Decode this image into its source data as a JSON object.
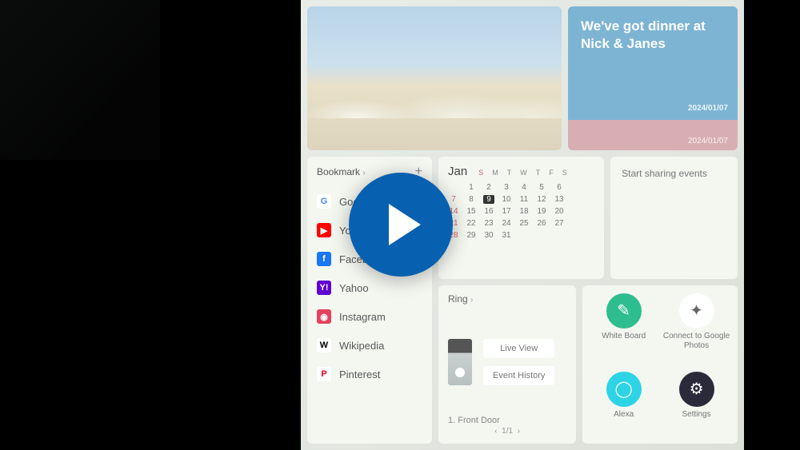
{
  "reminder": {
    "text": "We've got dinner at Nick & Janes",
    "date1": "2024/01/07",
    "date2": "2024/01/07"
  },
  "bookmark": {
    "title": "Bookmark",
    "items": [
      {
        "label": "Google",
        "icon": "G",
        "bg": "#fff",
        "fg": "#4285F4"
      },
      {
        "label": "YouTube",
        "icon": "▶",
        "bg": "#FF0000",
        "fg": "#fff"
      },
      {
        "label": "Facebook",
        "icon": "f",
        "bg": "#1877F2",
        "fg": "#fff"
      },
      {
        "label": "Yahoo",
        "icon": "Y!",
        "bg": "#6001D2",
        "fg": "#fff"
      },
      {
        "label": "Instagram",
        "icon": "◉",
        "bg": "#E4405F",
        "fg": "#fff"
      },
      {
        "label": "Wikipedia",
        "icon": "W",
        "bg": "#fff",
        "fg": "#000"
      },
      {
        "label": "Pinterest",
        "icon": "P",
        "bg": "#fff",
        "fg": "#E60023"
      }
    ]
  },
  "calendar": {
    "month": "Jan",
    "days": [
      "S",
      "M",
      "T",
      "W",
      "T",
      "F",
      "S"
    ],
    "today": 9,
    "weeks": [
      [
        "",
        "1",
        "2",
        "3",
        "4",
        "5",
        "6"
      ],
      [
        "7",
        "8",
        "9",
        "10",
        "11",
        "12",
        "13"
      ],
      [
        "14",
        "15",
        "16",
        "17",
        "18",
        "19",
        "20"
      ],
      [
        "21",
        "22",
        "23",
        "24",
        "25",
        "26",
        "27"
      ],
      [
        "28",
        "29",
        "30",
        "31",
        "",
        "",
        ""
      ]
    ]
  },
  "events": {
    "placeholder": "Start sharing events"
  },
  "ring": {
    "title": "Ring",
    "live": "Live View",
    "history": "Event History",
    "device": "1. Front Door",
    "pager": "1/1"
  },
  "apps": [
    {
      "label": "White Board",
      "bg": "#2dbd8e"
    },
    {
      "label": "Connect to Google Photos",
      "bg": "#ffffff"
    },
    {
      "label": "Alexa",
      "bg": "#2dd4e6"
    },
    {
      "label": "Settings",
      "bg": "#2a2a3a"
    }
  ]
}
